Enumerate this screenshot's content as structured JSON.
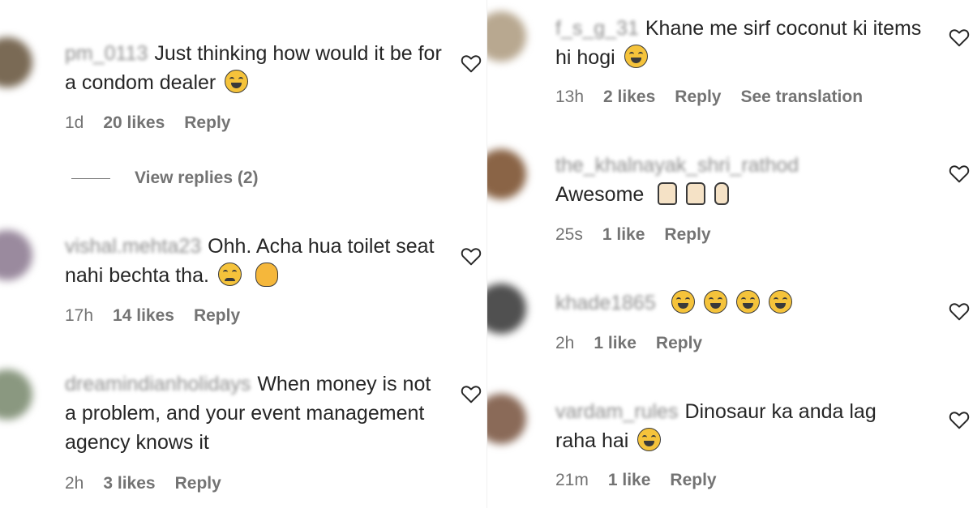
{
  "left_comments": [
    {
      "username": "pm_0113",
      "text": "Just thinking how would it be for a condom dealer",
      "emojis": [
        "face-with-tears-of-joy"
      ],
      "time": "1d",
      "likes": "20 likes",
      "reply": "Reply",
      "avatar_color": "#7a6a55"
    },
    {
      "username": "vishal.mehta23",
      "text": "Ohh. Acha hua toilet seat nahi bechta tha.",
      "emojis": [
        "sad-face",
        "clapping-hands"
      ],
      "time": "17h",
      "likes": "14 likes",
      "reply": "Reply",
      "avatar_color": "#9a8a9e"
    },
    {
      "username": "dreamindianholidays",
      "text": "When money is not a problem, and your event management agency knows it",
      "emojis": [],
      "time": "2h",
      "likes": "3 likes",
      "reply": "Reply",
      "avatar_color": "#8a9880"
    }
  ],
  "view_replies": "View replies (2)",
  "right_comments": [
    {
      "username": "f_s_g_31",
      "text": "Khane me sirf coconut ki items hi hogi",
      "emojis": [
        "grinning-face"
      ],
      "time": "13h",
      "likes": "2 likes",
      "reply": "Reply",
      "translate": "See translation",
      "avatar_color": "#b8a890"
    },
    {
      "username": "the_khalnayak_shri_rathod",
      "text": "Awesome",
      "emojis": [
        "raising-hands",
        "raising-hands",
        "victory-hand"
      ],
      "time": "25s",
      "likes": "1 like",
      "reply": "Reply",
      "avatar_color": "#8a6446"
    },
    {
      "username": "khade1865",
      "text": "",
      "emojis": [
        "face-with-tears-of-joy",
        "face-with-tears-of-joy",
        "face-with-tears-of-joy",
        "face-with-tears-of-joy"
      ],
      "time": "2h",
      "likes": "1 like",
      "reply": "Reply",
      "avatar_color": "#505050"
    },
    {
      "username": "vardam_rules",
      "text": "Dinosaur ka anda lag raha hai",
      "emojis": [
        "face-with-tears-of-joy"
      ],
      "time": "21m",
      "likes": "1 like",
      "reply": "Reply",
      "avatar_color": "#8a6a58"
    }
  ],
  "icons": {
    "like": "heart-outline-icon"
  },
  "colors": {
    "text": "#262626",
    "muted": "#737373",
    "username": "#8e8e8e"
  }
}
